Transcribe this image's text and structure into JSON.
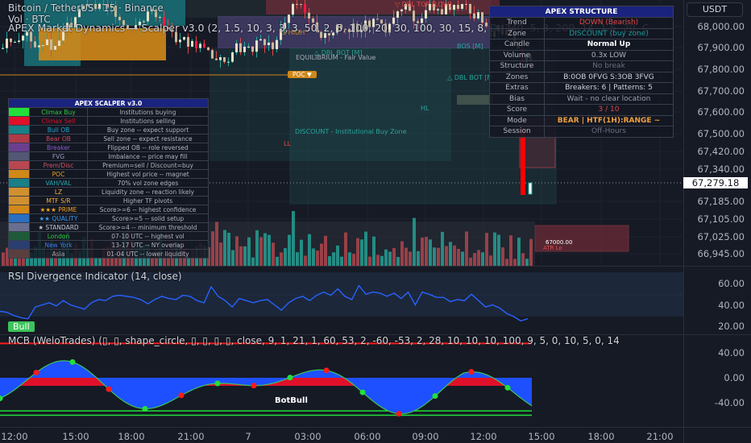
{
  "header": {
    "symbol_line": "Bitcoin / TetherUS · 15 · Binance",
    "vol_line": "Vol · BTC",
    "indicator_line": "APEX Market Dynamics — Scalper v3.0 (2, 1.5, 10, 3, 3, 3, 50, 2, 5, 100, 20, 30, 100, 30, 15, 8, D, 240, 5, 3, 200, 14, 1.5, 20, C"
  },
  "currency": "USDT",
  "price_axis": [
    "68,000.00",
    "67,900.00",
    "67,800.00",
    "67,700.00",
    "67,600.00",
    "67,500.00",
    "67,420.00",
    "67,340.00",
    "67,185.00",
    "67,105.00",
    "67,025.00",
    "66,945.00"
  ],
  "current_price": "67,279.18",
  "chart_labels": {
    "dbl_top": "▽ DBL TOP [LOW]",
    "dbl_bot": "△ DBL BOT [M]",
    "dbl_bot2": "△ DBL BOT [M",
    "equilibrium": "EQUILIBRIUM - Fair Value",
    "discount": "DISCOUNT - Institutional Buy Zone",
    "poc_tag": "POC ▼",
    "hl": "HL",
    "ll": "LL",
    "atr_price": "67000.00",
    "atr_label": "ATR Lo",
    "bos": "BOS [M]",
    "s_high": "S HIGH"
  },
  "scalper_table": {
    "title": "APEX SCALPER v3.0",
    "rows": [
      {
        "name": "Climax Buy",
        "desc": "Institutions buying",
        "swatch": "#22e03a",
        "color": "#2ecc40"
      },
      {
        "name": "Climax Sell",
        "desc": "Institutions selling",
        "swatch": "#e0102a",
        "color": "#e0102a"
      },
      {
        "name": "Bull OB",
        "desc": "Buy zone -- expect support",
        "swatch": "#1a7f86",
        "color": "#27a6c9"
      },
      {
        "name": "Bear OB",
        "desc": "Sell zone -- expect resistance",
        "swatch": "#b03a48",
        "color": "#d04a5a"
      },
      {
        "name": "Breaker",
        "desc": "Flipped OB -- role reversed",
        "swatch": "#6b3f8f",
        "color": "#8a5bd0"
      },
      {
        "name": "FVG",
        "desc": "Imbalance -- price may fill",
        "swatch": "#535775",
        "color": "#9a9fc0"
      },
      {
        "name": "Prem/Disc",
        "desc": "Premium=sell / Discount=buy",
        "swatch": "#b8474f",
        "color": "#d05560"
      },
      {
        "name": "POC",
        "desc": "Highest vol price -- magnet",
        "swatch": "#d08818",
        "color": "#f0a020"
      },
      {
        "name": "VAH/VAL",
        "desc": "70% vol zone edges",
        "swatch": "#1a7f86",
        "color": "#28a8b0"
      },
      {
        "name": "LZ",
        "desc": "Liquidity zone -- reaction likely",
        "swatch": "#d09030",
        "color": "#f0b040"
      },
      {
        "name": "MTF S/R",
        "desc": "Higher TF pivots",
        "swatch": "#d09030",
        "color": "#f0b040"
      },
      {
        "name": "★★★ PRIME",
        "desc": "Score>=6 -- highest confidence",
        "swatch": "#d08818",
        "color": "#f0a020"
      },
      {
        "name": "★★ QUALITY",
        "desc": "Score>=5 -- solid setup",
        "swatch": "#2a6fc0",
        "color": "#3a9af0"
      },
      {
        "name": "★ STANDARD",
        "desc": "Score>=4 -- minimum threshold",
        "swatch": "#6a6f90",
        "color": "#c0c3d0"
      },
      {
        "name": "London",
        "desc": "07-10 UTC -- highest vol",
        "swatch": "#1f5a3a",
        "color": "#2ecc40"
      },
      {
        "name": "New York",
        "desc": "13-17 UTC -- NY overlap",
        "swatch": "#2a3f70",
        "color": "#3a7af0"
      },
      {
        "name": "Asia",
        "desc": "01-04 UTC -- lower liquidity",
        "swatch": "#5a3f3f",
        "color": "#b0a0a0"
      }
    ]
  },
  "structure_table": {
    "title": "APEX  STRUCTURE",
    "rows": [
      {
        "label": "Trend",
        "value": "DOWN  (Bearish)",
        "color": "#e04848"
      },
      {
        "label": "Zone",
        "value": "DISCOUNT  (buy zone)",
        "color": "#1a9a9a"
      },
      {
        "label": "Candle",
        "value": "Normal Up",
        "color": "#ffffff"
      },
      {
        "label": "Volume",
        "value": "0.3x  LOW",
        "color": "#b2b5be"
      },
      {
        "label": "Structure",
        "value": "No break",
        "color": "#6a7080"
      },
      {
        "label": "Zones",
        "value": "B:0OB 0FVG  S:3OB 3FVG",
        "color": "#d1d4dc"
      },
      {
        "label": "Extras",
        "value": "Breakers: 6  |  Patterns: 5",
        "color": "#d1d4dc"
      },
      {
        "label": "Bias",
        "value": "Wait - no clear location",
        "color": "#9a9fb0"
      },
      {
        "label": "Score",
        "value": "3 / 10",
        "color": "#e04848"
      },
      {
        "label": "Mode",
        "value": "BEAR | HTF(1H):RANGE ~",
        "color": "#f0a040"
      },
      {
        "label": "Session",
        "value": "Off-Hours",
        "color": "#6a7080"
      }
    ]
  },
  "rsi": {
    "title": "RSI Divergence Indicator (14, close)",
    "axis": [
      "60.00",
      "40.00",
      "20.00"
    ],
    "bull_label": "Bull"
  },
  "mcb": {
    "title": "MCB (WeloTrades) (▯, ▯, shape_circle, ▯, ▯, ▯, ▯, close, 9, 1, 21, 1, 60, 53, 2, -60, -53, 2, 28, 10, 10, 10, 100, 9, 5, 0, 10, 5, 0, 14",
    "axis": [
      "40.00",
      "0.00",
      "-40.00"
    ],
    "signal_label": "BotBull"
  },
  "time_axis": [
    "12:00",
    "15:00",
    "18:00",
    "21:00",
    "7",
    "03:00",
    "06:00",
    "09:00",
    "12:00",
    "15:00",
    "18:00",
    "21:00"
  ],
  "chart_data": {
    "type": "line",
    "rsi_values": [
      34,
      33,
      30,
      28,
      27,
      38,
      40,
      42,
      39,
      44,
      40,
      38,
      36,
      42,
      45,
      44,
      48,
      49,
      48,
      47,
      45,
      41,
      45,
      48,
      46,
      45,
      49,
      48,
      44,
      42,
      57,
      48,
      44,
      38,
      46,
      44,
      42,
      44,
      45,
      40,
      35,
      42,
      46,
      48,
      44,
      49,
      52,
      49,
      55,
      48,
      45,
      58,
      50,
      52,
      51,
      48,
      51,
      46,
      52,
      40,
      52,
      50,
      47,
      47,
      43,
      45,
      44,
      50,
      44,
      38,
      40,
      37,
      32,
      29,
      25,
      27
    ],
    "mcb_wave_min": -60,
    "mcb_wave_max": 30
  }
}
